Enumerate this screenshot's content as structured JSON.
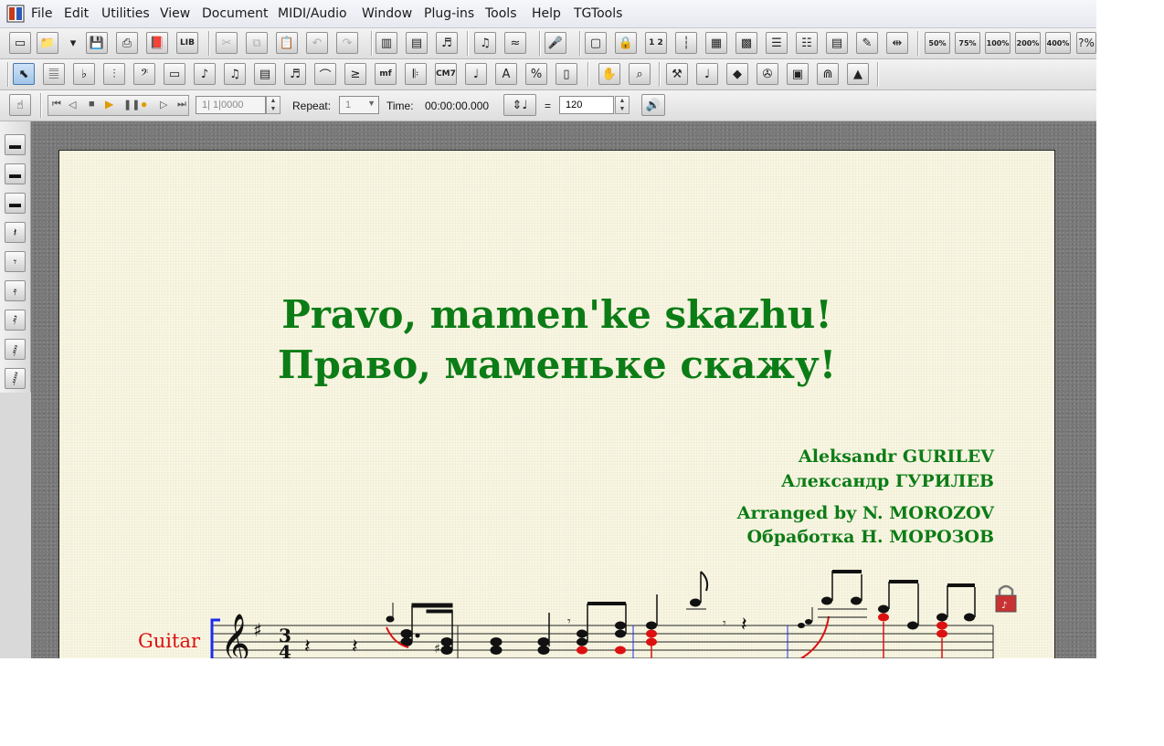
{
  "menu": [
    "File",
    "Edit",
    "Utilities",
    "View",
    "Document",
    "MIDI/Audio",
    "Window",
    "Plug-ins",
    "Tools",
    "Help",
    "TGTools"
  ],
  "toolbar1": {
    "icons": [
      "new-file-icon",
      "open-file-icon",
      "dropdown-arrow-icon",
      "save-icon",
      "print-icon",
      "library-icon",
      "library-lib-icon",
      "cut-icon",
      "copy-icon",
      "paste-icon",
      "undo-icon",
      "redo-icon",
      "page-view-icon",
      "scroll-view-icon",
      "mixer-icon",
      "playback-icon",
      "swing-icon",
      "microphone-icon",
      "frame-icon",
      "lock-page-icon",
      "page-number-icon",
      "measure-number-icon",
      "grid-icon",
      "staff-grid-icon",
      "layout-icon",
      "layout-alt-icon",
      "page-setup-icon",
      "edit-page-icon",
      "measure-layout-icon"
    ],
    "lib_label": "LIB",
    "page_number_label": "1 2",
    "zoom_levels": [
      "50%",
      "75%",
      "100%",
      "200%",
      "400%"
    ],
    "help_label": "?%"
  },
  "toolbar2": {
    "icons": [
      "selection-tool-icon",
      "staff-tool-icon",
      "key-signature-icon",
      "time-signature-icon",
      "clef-tool-icon",
      "measure-tool-icon",
      "simple-entry-icon",
      "speedy-entry-icon",
      "hyperscribe-icon",
      "tuplet-tool-icon",
      "smart-shape-icon",
      "articulation-icon",
      "expression-icon",
      "repeat-tool-icon",
      "chord-tool-icon",
      "lyrics-tool-icon",
      "text-tool-icon",
      "resize-tool-icon",
      "page-layout-icon",
      "hand-grabber-icon",
      "zoom-icon",
      "mass-edit-icon",
      "note-mover-icon",
      "special-tools-icon",
      "mirror-tool-icon",
      "graphics-tool-icon",
      "tie-tool-icon",
      "metronome-icon"
    ],
    "expression_label": "mf",
    "chord_label": "CM7",
    "text_label": "A",
    "resize_label": "%"
  },
  "toolbar3": {
    "counter": "1| 1|0000",
    "repeat_label": "Repeat:",
    "repeat_value": "1",
    "time_label": "Time:",
    "time_value": "00:00:00.000",
    "equals": "=",
    "tempo": "120"
  },
  "palette": [
    "whole-rest-icon",
    "half-rest-icon",
    "half-rest-alt-icon",
    "quarter-rest-icon",
    "eighth-rest-icon",
    "sixteenth-rest-icon",
    "thirty-second-rest-icon",
    "sixty-fourth-rest-icon",
    "one-twenty-eighth-rest-icon"
  ],
  "score": {
    "title_en": "Pravo, mamen'ke skazhu!",
    "title_ru": "Право, маменьке скажу!",
    "composer_en": "Aleksandr GURILEV",
    "composer_ru": "Александр ГУРИЛЕВ",
    "arranger_en": "Arranged by N. MOROZOV",
    "arranger_ru": "Обработка Н. МОРОЗОВ",
    "instrument": "Guitar",
    "time_signature": "3/4",
    "key_signature": "G major (1 sharp)",
    "title_color": "#0c7c16",
    "instrument_color": "#dd1010"
  }
}
